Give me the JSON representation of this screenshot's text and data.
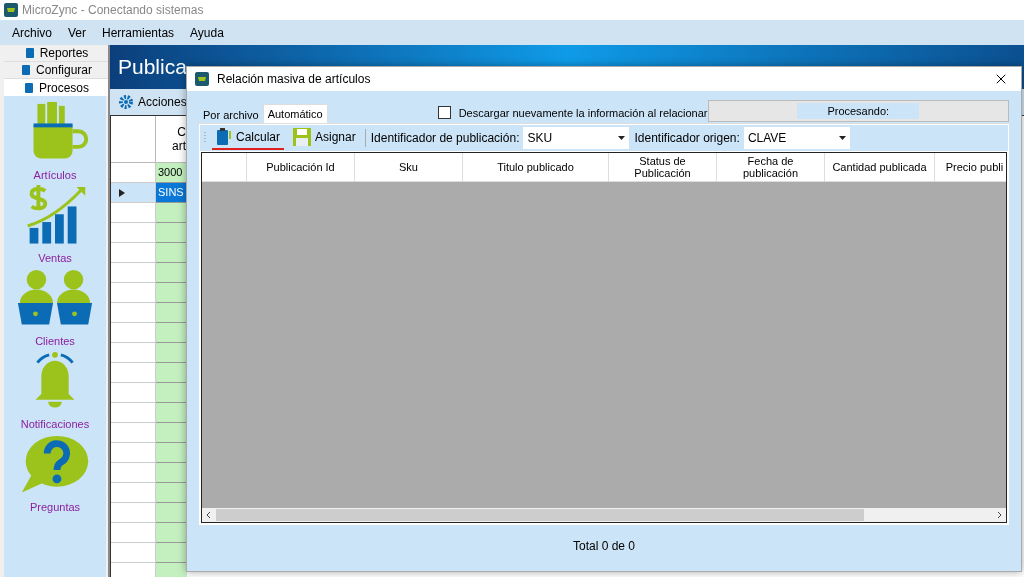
{
  "window": {
    "title": "MicroZync - Conectando sistemas"
  },
  "menu": [
    "Archivo",
    "Ver",
    "Herramientas",
    "Ayuda"
  ],
  "nav_tabs": [
    {
      "label": "Reportes",
      "selected": false
    },
    {
      "label": "Configurar",
      "selected": false
    },
    {
      "label": "Procesos",
      "selected": true
    }
  ],
  "nav_items": [
    "Artículos",
    "Ventas",
    "Clientes",
    "Notificaciones",
    "Preguntas"
  ],
  "main": {
    "title": "Publica",
    "toolbar": "Acciones",
    "grid": {
      "column_1": [
        "C",
        "art"
      ],
      "rows": [
        {
          "cell": "3000",
          "selected": false
        },
        {
          "cell": "SINS",
          "selected": true
        }
      ]
    }
  },
  "dialog": {
    "title": "Relación masiva de artículos",
    "tabs": [
      {
        "label": "Por archivo",
        "selected": false
      },
      {
        "label": "Automático",
        "selected": true
      }
    ],
    "checkbox": {
      "label": "Descargar nuevamente la información al relacionar",
      "checked": false
    },
    "progress": {
      "label": "Procesando:",
      "level": 0
    },
    "buttons": [
      {
        "label": "Calcular",
        "selected": true
      },
      {
        "label": "Asignar",
        "selected": false
      }
    ],
    "fields": [
      {
        "label": "Identificador de publicación:",
        "value": "SKU"
      },
      {
        "label": "Identificador origen:",
        "value": "CLAVE"
      }
    ],
    "columns": [
      "Publicación Id",
      "Sku",
      "Titulo publicado",
      "Status de Publicación",
      "Fecha de publicación",
      "Cantidad publicada",
      "Precio publi"
    ],
    "footer": "Total 0 de 0"
  }
}
